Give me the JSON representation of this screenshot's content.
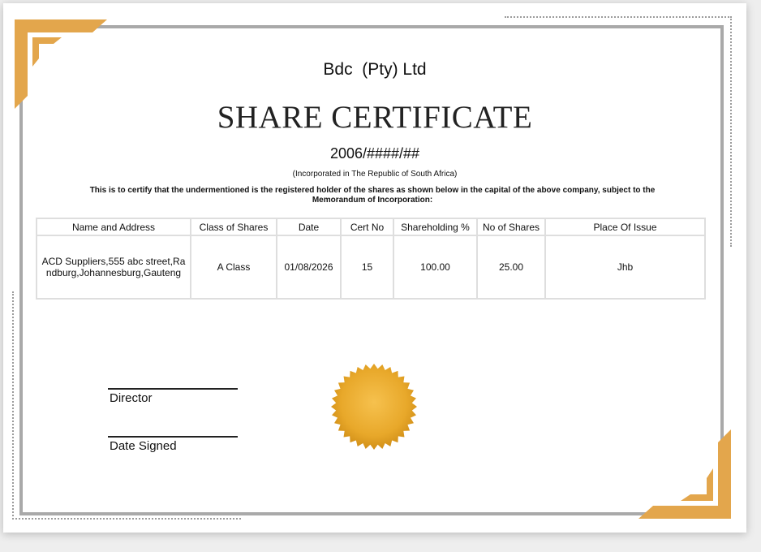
{
  "certificate": {
    "company_name": "Bdc  (Pty) Ltd",
    "title": "SHARE CERTIFICATE",
    "certificate_number": "2006/####/##",
    "incorporated": "(Incorporated in The Republic of South Africa)",
    "certify_text": "This is to certify that the undermentioned is the registered holder of the shares as shown below in the capital of the above company, subject to the Memorandum of Incorporation:"
  },
  "table": {
    "headers": [
      "Name and Address",
      "Class of Shares",
      "Date",
      "Cert No",
      "Shareholding %",
      "No of Shares",
      "Place Of Issue"
    ],
    "row": [
      "ACD Suppliers,555 abc street,Randburg,Johannesburg,Gauteng",
      "A Class",
      "01/08/2026",
      "15",
      "100.00",
      "25.00",
      "Jhb"
    ]
  },
  "signatures": {
    "director_label": "Director",
    "date_label": "Date Signed"
  },
  "colors": {
    "gold": "#e3a64c",
    "seal": "#e8a82a",
    "frame": "#a9a9a9"
  }
}
